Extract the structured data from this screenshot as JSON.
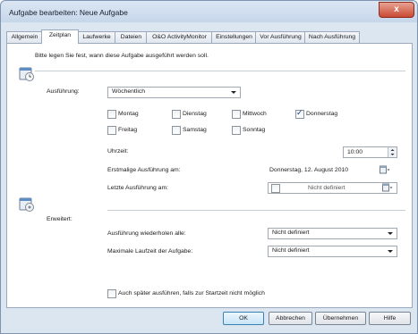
{
  "window": {
    "title": "Aufgabe bearbeiten: Neue Aufgabe",
    "close_symbol": "x"
  },
  "tabs": [
    {
      "label": "Allgemein"
    },
    {
      "label": "Zeitplan"
    },
    {
      "label": "Laufwerke"
    },
    {
      "label": "Dateien"
    },
    {
      "label": "O&O ActivityMonitor"
    },
    {
      "label": "Einstellungen"
    },
    {
      "label": "Vor Ausführung"
    },
    {
      "label": "Nach Ausführung"
    }
  ],
  "active_tab": "Zeitplan",
  "schedule": {
    "intro": "Bitte legen Sie fest, wann diese Aufgabe ausgeführt werden soll.",
    "execution_label": "Ausführung:",
    "execution_value": "Wöchentlich",
    "days": [
      {
        "label": "Montag",
        "checked": false
      },
      {
        "label": "Dienstag",
        "checked": false
      },
      {
        "label": "Mittwoch",
        "checked": false
      },
      {
        "label": "Donnerstag",
        "checked": true
      },
      {
        "label": "Freitag",
        "checked": false
      },
      {
        "label": "Samstag",
        "checked": false
      },
      {
        "label": "Sonntag",
        "checked": false
      }
    ],
    "time_label": "Uhrzeit:",
    "time_value": "10:00",
    "first_run_label": "Erstmalige Ausführung am:",
    "first_run_value": "Donnerstag, 12. August 2010",
    "last_run_label": "Letzte Ausführung am:",
    "last_run_value": "Nicht definiert"
  },
  "advanced": {
    "label": "Erweitert:",
    "repeat_label": "Ausführung wiederholen alle:",
    "repeat_value": "Nicht definiert",
    "max_runtime_label": "Maximale Laufzeit der Aufgabe:",
    "max_runtime_value": "Nicht definiert",
    "run_later_label": "Auch später ausführen, falls zur Startzeit nicht möglich"
  },
  "buttons": {
    "ok": "OK",
    "cancel": "Abbrechen",
    "apply": "Übernehmen",
    "help": "Hilfe"
  }
}
